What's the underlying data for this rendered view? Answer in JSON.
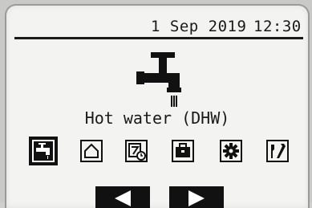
{
  "header": {
    "date": "1 Sep 2019",
    "time": "12:30"
  },
  "main": {
    "mode_label": "Hot water (DHW)"
  },
  "menu": {
    "items": [
      {
        "icon": "hot-water-tap-icon",
        "selected": true
      },
      {
        "icon": "house-icon",
        "selected": false
      },
      {
        "icon": "schedule-icon",
        "selected": false
      },
      {
        "icon": "holiday-suitcase-icon",
        "selected": false
      },
      {
        "icon": "settings-gear-icon",
        "selected": false
      },
      {
        "icon": "service-tools-icon",
        "selected": false
      }
    ]
  },
  "colors": {
    "lcd_background": "#f3f3f1",
    "ink": "#111111",
    "bezel": "#c9cac7"
  }
}
